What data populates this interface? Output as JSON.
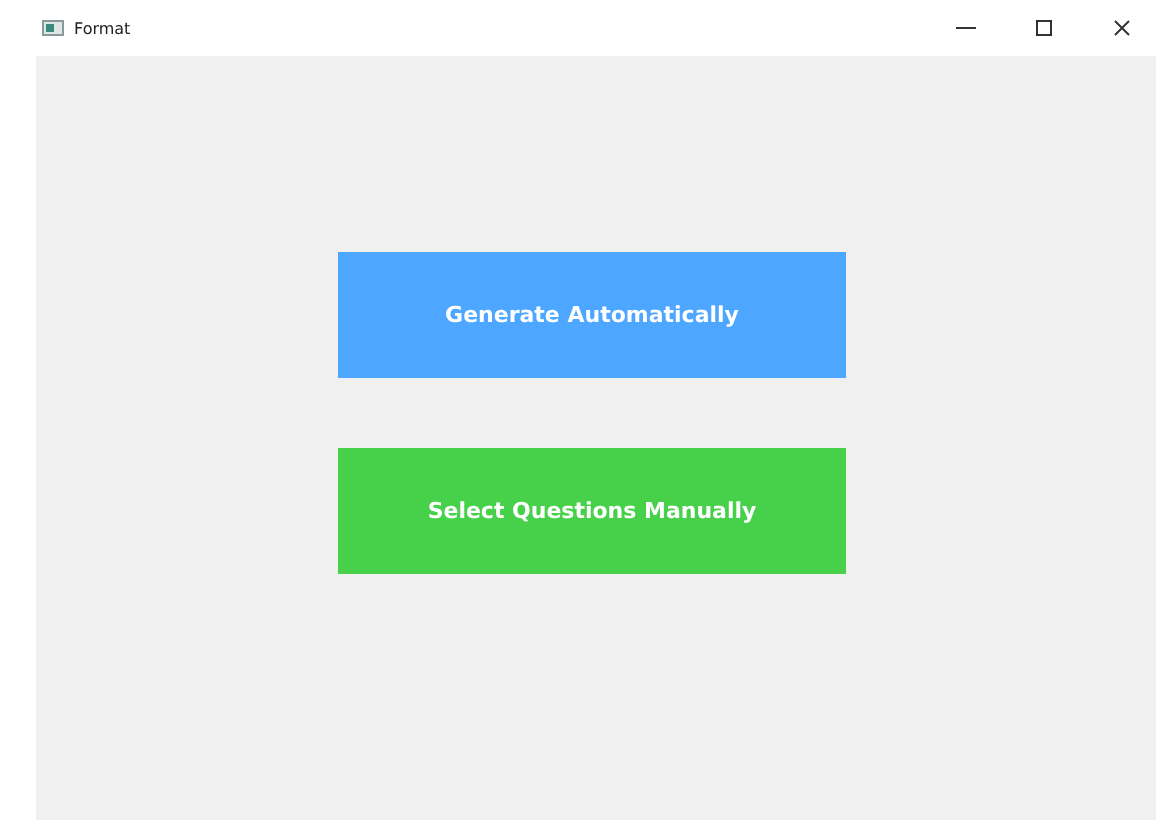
{
  "window": {
    "title": "Format"
  },
  "buttons": [
    {
      "label": "Generate Automatically",
      "color": "#4da6ff"
    },
    {
      "label": "Select Questions Manually",
      "color": "#47d14a"
    }
  ]
}
